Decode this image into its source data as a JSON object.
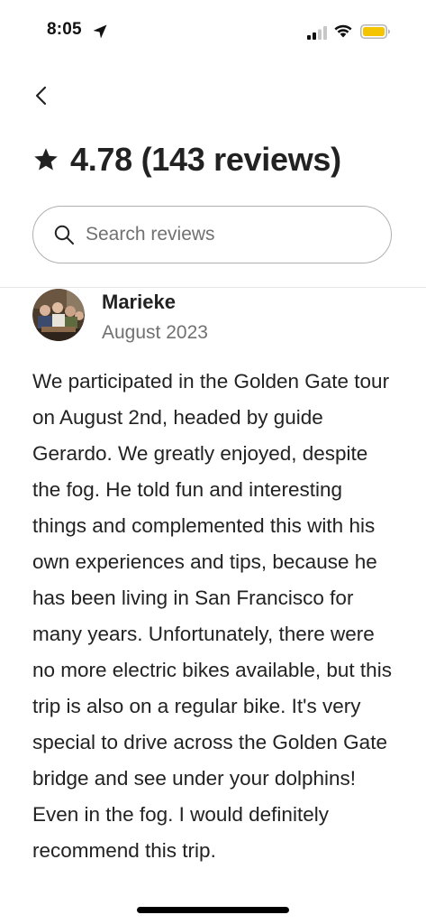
{
  "status_bar": {
    "time": "8:05",
    "location_icon": "location-arrow-icon",
    "signal_icon": "cellular-signal-icon",
    "wifi_icon": "wifi-icon",
    "battery_icon": "battery-icon",
    "battery_color": "#F5C400"
  },
  "header": {
    "back_icon": "chevron-left-icon",
    "star_icon": "star-icon",
    "rating_summary": "4.78 (143 reviews)"
  },
  "search": {
    "icon": "search-icon",
    "placeholder": "Search reviews",
    "value": ""
  },
  "reviews": [
    {
      "avatar_icon": "reviewer-photo",
      "name": "Marieke",
      "date": "August 2023",
      "text": "We participated in the Golden Gate tour on August 2nd, headed by guide Gerardo. We greatly enjoyed, despite the fog. He told fun and interesting things and complemented this with his own experiences and tips, because he has been living in San Francisco for many years. Unfortunately, there were no more electric bikes available, but this trip is also on a regular bike. It's very special to drive across the Golden Gate bridge and see under your dolphins! Even in the fog. I would definitely recommend this trip."
    }
  ],
  "colors": {
    "text_primary": "#222222",
    "text_secondary": "#717171",
    "border": "#B0B0B0"
  }
}
